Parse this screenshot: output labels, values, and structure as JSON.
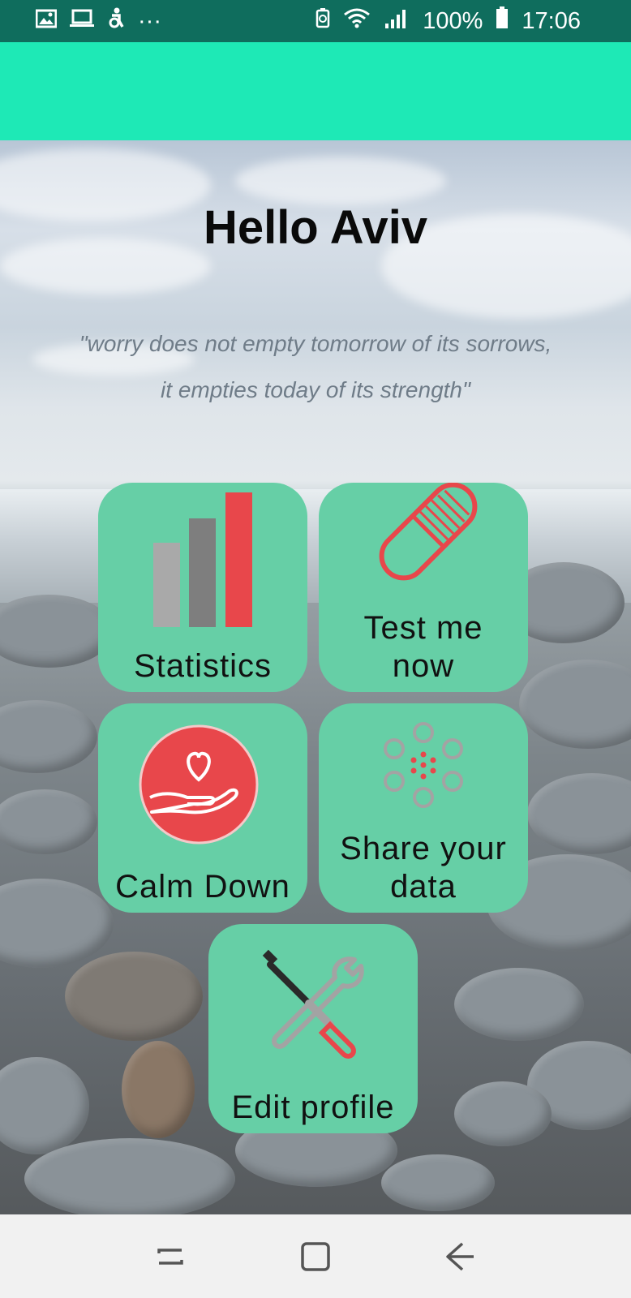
{
  "status_bar": {
    "battery_percent": "100%",
    "time": "17:06",
    "left_icons": [
      "image-icon",
      "laptop-icon",
      "accessibility-icon",
      "more-icon"
    ],
    "more_glyph": "···"
  },
  "main": {
    "greeting": "Hello Aviv",
    "quote_line1": "\"worry does not empty tomorrow of its sorrows,",
    "quote_line2": "it empties today of its strength\""
  },
  "tiles": [
    {
      "label": "Statistics",
      "icon": "bar-chart-icon"
    },
    {
      "label": "Test me now",
      "icon": "pill-icon"
    },
    {
      "label": "Calm Down",
      "icon": "heart-hand-icon"
    },
    {
      "label": "Share your data",
      "icon": "share-dots-icon"
    },
    {
      "label": "Edit profile",
      "icon": "tools-icon"
    }
  ],
  "colors": {
    "status_bar": "#0f6d5d",
    "app_bar": "#1ee9b6",
    "tile": "#66cfa6",
    "accent_red": "#e8474b",
    "icon_gray": "#a3a3a3"
  },
  "nav": {
    "buttons": [
      "recents-button",
      "home-button",
      "back-button"
    ]
  }
}
